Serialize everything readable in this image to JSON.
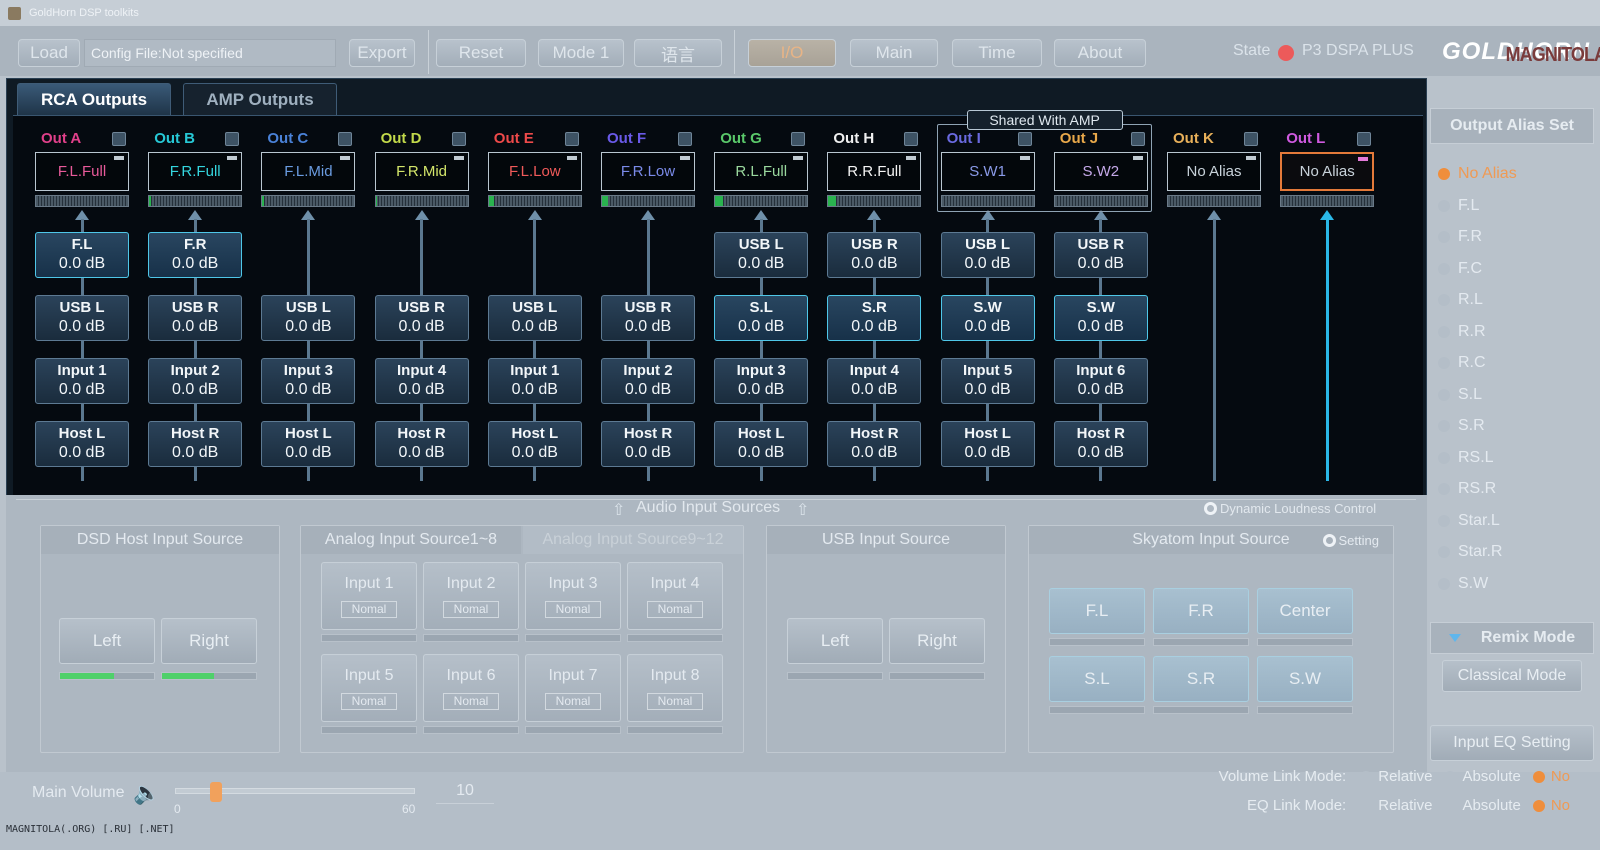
{
  "window": {
    "title": "GoldHorn DSP toolkits"
  },
  "toolbar": {
    "load": "Load",
    "config_file": "Config File:Not specified",
    "export": "Export",
    "reset": "Reset",
    "mode": "Mode 1",
    "lang": "语言",
    "tabs": [
      "I/O",
      "Main",
      "Time",
      "About"
    ],
    "active_tab": "I/O",
    "state_label": "State",
    "state_color": "#ec5a5a",
    "device": "P3 DSPA PLUS",
    "brand": "GOLDHORN",
    "watermark": "MAGNITOLA"
  },
  "output_tabs": {
    "rca": "RCA Outputs",
    "amp": "AMP Outputs"
  },
  "shared_label": "Shared With AMP",
  "outputs": [
    {
      "label": "Out  A",
      "color": "#e0408a",
      "alias": "F.L.Full",
      "alias_color": "#e85a9a",
      "level": 0,
      "sources": [
        {
          "n": "F.L",
          "v": "0.0 dB",
          "hl": true
        },
        {
          "n": "USB L",
          "v": "0.0 dB"
        },
        {
          "n": "Input 1",
          "v": "0.0 dB"
        },
        {
          "n": "Host L",
          "v": "0.0 dB"
        }
      ]
    },
    {
      "label": "Out  B",
      "color": "#27c9d6",
      "alias": "F.R.Full",
      "alias_color": "#34d5de",
      "level": 0.02,
      "sources": [
        {
          "n": "F.R",
          "v": "0.0 dB",
          "hl": true
        },
        {
          "n": "USB R",
          "v": "0.0 dB"
        },
        {
          "n": "Input 2",
          "v": "0.0 dB"
        },
        {
          "n": "Host R",
          "v": "0.0 dB"
        }
      ]
    },
    {
      "label": "Out  C",
      "color": "#4a82d8",
      "alias": "F.L.Mid",
      "alias_color": "#6a9be0",
      "level": 0.02,
      "sources": [
        null,
        {
          "n": "USB L",
          "v": "0.0 dB"
        },
        {
          "n": "Input 3",
          "v": "0.0 dB"
        },
        {
          "n": "Host L",
          "v": "0.0 dB"
        }
      ]
    },
    {
      "label": "Out  D",
      "color": "#c2d94a",
      "alias": "F.R.Mid",
      "alias_color": "#d3e56a",
      "level": 0.02,
      "sources": [
        null,
        {
          "n": "USB R",
          "v": "0.0 dB"
        },
        {
          "n": "Input 4",
          "v": "0.0 dB"
        },
        {
          "n": "Host R",
          "v": "0.0 dB"
        }
      ]
    },
    {
      "label": "Out  E",
      "color": "#ee4a4a",
      "alias": "F.L.Low",
      "alias_color": "#f05a5a",
      "level": 0.06,
      "sources": [
        null,
        {
          "n": "USB L",
          "v": "0.0 dB"
        },
        {
          "n": "Input 1",
          "v": "0.0 dB"
        },
        {
          "n": "Host L",
          "v": "0.0 dB"
        }
      ]
    },
    {
      "label": "Out  F",
      "color": "#6a5ae8",
      "alias": "F.R.Low",
      "alias_color": "#7a8ae8",
      "level": 0.06,
      "sources": [
        null,
        {
          "n": "USB R",
          "v": "0.0 dB"
        },
        {
          "n": "Input 2",
          "v": "0.0 dB"
        },
        {
          "n": "Host R",
          "v": "0.0 dB"
        }
      ]
    },
    {
      "label": "Out  G",
      "color": "#5ac86a",
      "alias": "R.L.Full",
      "alias_color": "#9ad89e",
      "level": 0.08,
      "sources": [
        {
          "n": "USB L",
          "v": "0.0 dB"
        },
        {
          "n": "S.L",
          "v": "0.0 dB",
          "hl": true
        },
        {
          "n": "Input 3",
          "v": "0.0 dB"
        },
        {
          "n": "Host L",
          "v": "0.0 dB"
        }
      ]
    },
    {
      "label": "Out  H",
      "color": "#f0f0f0",
      "alias": "R.R.Full",
      "alias_color": "#f4f4f4",
      "level": 0.08,
      "sources": [
        {
          "n": "USB R",
          "v": "0.0 dB"
        },
        {
          "n": "S.R",
          "v": "0.0 dB",
          "hl": true
        },
        {
          "n": "Input 4",
          "v": "0.0 dB"
        },
        {
          "n": "Host R",
          "v": "0.0 dB"
        }
      ]
    },
    {
      "label": "Out  I",
      "color": "#6a6ae0",
      "alias": "S.W1",
      "alias_color": "#8a9ae8",
      "level": 0,
      "sources": [
        {
          "n": "USB L",
          "v": "0.0 dB"
        },
        {
          "n": "S.W",
          "v": "0.0 dB",
          "hl": true
        },
        {
          "n": "Input 5",
          "v": "0.0 dB"
        },
        {
          "n": "Host L",
          "v": "0.0 dB"
        }
      ]
    },
    {
      "label": "Out  J",
      "color": "#e8a84a",
      "alias": "S.W2",
      "alias_color": "#c4a8e8",
      "level": 0,
      "sources": [
        {
          "n": "USB R",
          "v": "0.0 dB"
        },
        {
          "n": "S.W",
          "v": "0.0 dB",
          "hl": true
        },
        {
          "n": "Input 6",
          "v": "0.0 dB"
        },
        {
          "n": "Host R",
          "v": "0.0 dB"
        }
      ]
    },
    {
      "label": "Out  K",
      "color": "#e8b05a",
      "alias": "No Alias",
      "alias_color": "#c8d2da",
      "level": 0,
      "sources": [
        null,
        null,
        null,
        null
      ]
    },
    {
      "label": "Out  L",
      "color": "#d05ae0",
      "alias": "No Alias",
      "alias_color": "#c8d2da",
      "level": 0,
      "selected": true,
      "sources": [
        null,
        null,
        null,
        null
      ]
    }
  ],
  "audio_sources": {
    "title": "Audio Input Sources",
    "dynamic_loudness": "Dynamic Loudness Control",
    "dsd": {
      "title": "DSD Host Input Source",
      "left": "Left",
      "right": "Right",
      "left_level": 0.95,
      "right_level": 0.55
    },
    "analog": {
      "tab1": "Analog Input Source1~8",
      "tab2": "Analog Input Source9~12",
      "inputs": [
        {
          "n": "Input 1",
          "p": "Nomal"
        },
        {
          "n": "Input 2",
          "p": "Nomal"
        },
        {
          "n": "Input 3",
          "p": "Nomal"
        },
        {
          "n": "Input 4",
          "p": "Nomal"
        },
        {
          "n": "Input 5",
          "p": "Nomal"
        },
        {
          "n": "Input 6",
          "p": "Nomal"
        },
        {
          "n": "Input 7",
          "p": "Nomal"
        },
        {
          "n": "Input 8",
          "p": "Nomal"
        }
      ]
    },
    "usb": {
      "title": "USB Input Source",
      "left": "Left",
      "right": "Right"
    },
    "skyatom": {
      "title": "Skyatom Input Source",
      "setting": "Setting",
      "channels": [
        "F.L",
        "F.R",
        "Center",
        "S.L",
        "S.R",
        "S.W"
      ]
    }
  },
  "alias_set": {
    "title": "Output Alias Set",
    "items": [
      "No Alias",
      "F.L",
      "F.R",
      "F.C",
      "R.L",
      "R.R",
      "R.C",
      "S.L",
      "S.R",
      "RS.L",
      "RS.R",
      "Star.L",
      "Star.R",
      "S.W"
    ],
    "selected": "No Alias"
  },
  "remix": {
    "title": "Remix Mode",
    "mode": "Classical Mode",
    "eq_setting": "Input EQ Setting"
  },
  "volume": {
    "label": "Main Volume",
    "value": "10",
    "min": "0",
    "max": "60",
    "fraction": 0.167
  },
  "link_modes": [
    {
      "label": "Volume Link Mode:",
      "options": [
        "Relative",
        "Absolute",
        "No"
      ],
      "selected": "No"
    },
    {
      "label": "EQ Link Mode:",
      "options": [
        "Relative",
        "Absolute",
        "No"
      ],
      "selected": "No"
    }
  ],
  "credit": "MAGNITOLA(.ORG) [.RU] [.NET]"
}
